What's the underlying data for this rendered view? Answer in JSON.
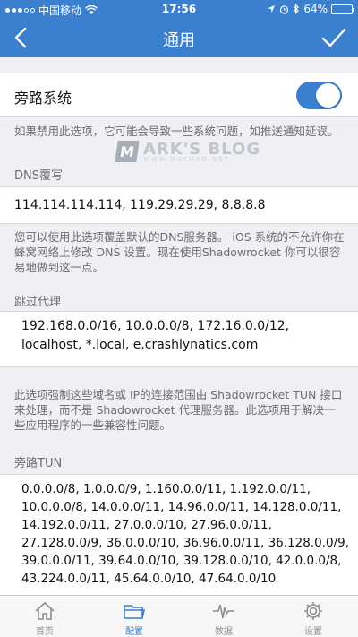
{
  "status_bar": {
    "carrier": "中国移动",
    "time": "17:56",
    "battery_percent": "64%",
    "battery_level": 0.64,
    "icons": [
      "signal-dots-icon",
      "wifi-icon",
      "location-icon",
      "alarm-icon",
      "bluetooth-icon",
      "battery-icon"
    ]
  },
  "navbar": {
    "title": "通用",
    "back_icon": "chevron-left-icon",
    "done_icon": "checkmark-icon"
  },
  "bypass_system": {
    "label": "旁路系统",
    "enabled": true,
    "note": "如果禁用此选项，它可能会导致一些系统问题，如推送通知延误。"
  },
  "watermark": {
    "letter": "M",
    "title": "ARK'S BLOG",
    "subtitle": "WWW.DUCHAO.NET"
  },
  "dns": {
    "header": "DNS覆写",
    "value": "114.114.114.114, 119.29.29.29, 8.8.8.8",
    "note": "您可以使用此选项覆盖默认的DNS服务器。 iOS 系统的不允许你在蜂窝网络上修改 DNS 设置。现在使用Shadowrocket 你可以很容易地做到这一点。"
  },
  "skip_proxy": {
    "header": "跳过代理",
    "value": "192.168.0.0/16, 10.0.0.0/8, 172.16.0.0/12, localhost, *.local, e.crashlynatics.com",
    "note": "此选项强制这些域名或 IP的连接范围由 Shadowrocket TUN 接口来处理，而不是 Shadowrocket 代理服务器。此选项用于解决一些应用程序的一些兼容性问题。"
  },
  "bypass_tun": {
    "header": "旁路TUN",
    "value": "0.0.0.0/8, 1.0.0.0/9, 1.160.0.0/11, 1.192.0.0/11, 10.0.0.0/8, 14.0.0.0/11, 14.96.0.0/11, 14.128.0.0/11, 14.192.0.0/11, 27.0.0.0/10, 27.96.0.0/11, 27.128.0.0/9, 36.0.0.0/10, 36.96.0.0/11, 36.128.0.0/9, 39.0.0.0/11, 39.64.0.0/10, 39.128.0.0/10, 42.0.0.0/8, 43.224.0.0/11, 45.64.0.0/10, 47.64.0.0/10"
  },
  "tabbar": {
    "tabs": [
      {
        "label": "首页",
        "icon": "home-icon",
        "active": false
      },
      {
        "label": "配置",
        "icon": "folder-icon",
        "active": true
      },
      {
        "label": "数据",
        "icon": "waveform-icon",
        "active": false
      },
      {
        "label": "设置",
        "icon": "gear-icon",
        "active": false
      }
    ]
  },
  "colors": {
    "accent": "#3b7fcf",
    "background": "#efeff4",
    "muted_text": "#6d6d72"
  }
}
